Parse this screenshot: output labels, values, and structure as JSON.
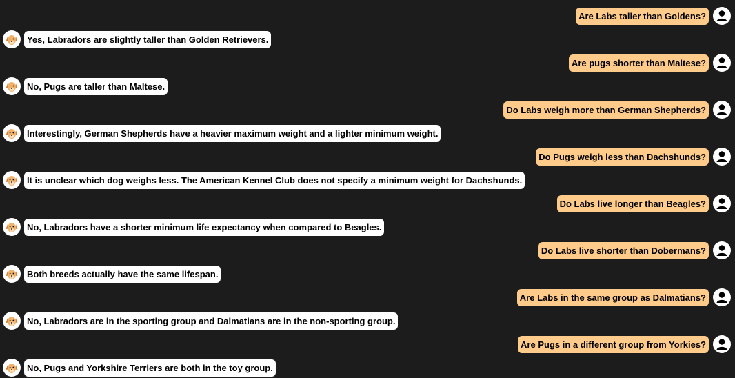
{
  "conversation": [
    {
      "role": "user",
      "text": "Are Labs taller than Goldens?"
    },
    {
      "role": "bot",
      "text": "Yes, Labradors are slightly taller than Golden Retrievers."
    },
    {
      "role": "user",
      "text": "Are pugs shorter than Maltese?"
    },
    {
      "role": "bot",
      "text": "No, Pugs are taller than Maltese."
    },
    {
      "role": "user",
      "text": "Do Labs weigh more than German Shepherds?"
    },
    {
      "role": "bot",
      "text": "Interestingly, German Shepherds have a heavier maximum weight and a lighter minimum weight."
    },
    {
      "role": "user",
      "text": "Do Pugs weigh less than Dachshunds?"
    },
    {
      "role": "bot",
      "text": "It is unclear which dog weighs less. The American Kennel Club does not specify a minimum weight for Dachshunds."
    },
    {
      "role": "user",
      "text": "Do Labs live longer than Beagles?"
    },
    {
      "role": "bot",
      "text": "No, Labradors have a shorter minimum life expectancy when compared to Beagles."
    },
    {
      "role": "user",
      "text": "Do Labs live shorter than Dobermans?"
    },
    {
      "role": "bot",
      "text": "Both breeds actually have the same lifespan."
    },
    {
      "role": "user",
      "text": "Are Labs in the same group as Dalmatians?"
    },
    {
      "role": "bot",
      "text": "No, Labradors are in the sporting group and Dalmatians are in the non-sporting group."
    },
    {
      "role": "user",
      "text": "Are Pugs in a different group from Yorkies?"
    },
    {
      "role": "bot",
      "text": "No, Pugs and Yorkshire Terriers are both in the toy group."
    }
  ],
  "icons": {
    "user": "user-avatar-icon",
    "bot": "dog-avatar-icon"
  },
  "colors": {
    "background": "#1c1c1c",
    "user_bubble": "#fecb8b",
    "bot_bubble": "#ffffff"
  }
}
